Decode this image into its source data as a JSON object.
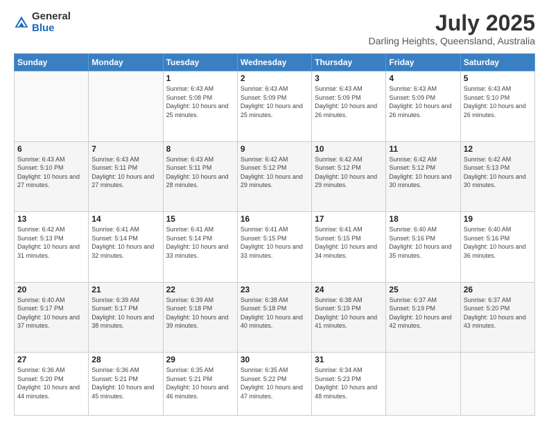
{
  "logo": {
    "general": "General",
    "blue": "Blue"
  },
  "header": {
    "month_year": "July 2025",
    "location": "Darling Heights, Queensland, Australia"
  },
  "days_of_week": [
    "Sunday",
    "Monday",
    "Tuesday",
    "Wednesday",
    "Thursday",
    "Friday",
    "Saturday"
  ],
  "weeks": [
    [
      {
        "day": "",
        "sunrise": "",
        "sunset": "",
        "daylight": ""
      },
      {
        "day": "",
        "sunrise": "",
        "sunset": "",
        "daylight": ""
      },
      {
        "day": "1",
        "sunrise": "Sunrise: 6:43 AM",
        "sunset": "Sunset: 5:08 PM",
        "daylight": "Daylight: 10 hours and 25 minutes."
      },
      {
        "day": "2",
        "sunrise": "Sunrise: 6:43 AM",
        "sunset": "Sunset: 5:09 PM",
        "daylight": "Daylight: 10 hours and 25 minutes."
      },
      {
        "day": "3",
        "sunrise": "Sunrise: 6:43 AM",
        "sunset": "Sunset: 5:09 PM",
        "daylight": "Daylight: 10 hours and 26 minutes."
      },
      {
        "day": "4",
        "sunrise": "Sunrise: 6:43 AM",
        "sunset": "Sunset: 5:09 PM",
        "daylight": "Daylight: 10 hours and 26 minutes."
      },
      {
        "day": "5",
        "sunrise": "Sunrise: 6:43 AM",
        "sunset": "Sunset: 5:10 PM",
        "daylight": "Daylight: 10 hours and 26 minutes."
      }
    ],
    [
      {
        "day": "6",
        "sunrise": "Sunrise: 6:43 AM",
        "sunset": "Sunset: 5:10 PM",
        "daylight": "Daylight: 10 hours and 27 minutes."
      },
      {
        "day": "7",
        "sunrise": "Sunrise: 6:43 AM",
        "sunset": "Sunset: 5:11 PM",
        "daylight": "Daylight: 10 hours and 27 minutes."
      },
      {
        "day": "8",
        "sunrise": "Sunrise: 6:43 AM",
        "sunset": "Sunset: 5:11 PM",
        "daylight": "Daylight: 10 hours and 28 minutes."
      },
      {
        "day": "9",
        "sunrise": "Sunrise: 6:42 AM",
        "sunset": "Sunset: 5:12 PM",
        "daylight": "Daylight: 10 hours and 29 minutes."
      },
      {
        "day": "10",
        "sunrise": "Sunrise: 6:42 AM",
        "sunset": "Sunset: 5:12 PM",
        "daylight": "Daylight: 10 hours and 29 minutes."
      },
      {
        "day": "11",
        "sunrise": "Sunrise: 6:42 AM",
        "sunset": "Sunset: 5:12 PM",
        "daylight": "Daylight: 10 hours and 30 minutes."
      },
      {
        "day": "12",
        "sunrise": "Sunrise: 6:42 AM",
        "sunset": "Sunset: 5:13 PM",
        "daylight": "Daylight: 10 hours and 30 minutes."
      }
    ],
    [
      {
        "day": "13",
        "sunrise": "Sunrise: 6:42 AM",
        "sunset": "Sunset: 5:13 PM",
        "daylight": "Daylight: 10 hours and 31 minutes."
      },
      {
        "day": "14",
        "sunrise": "Sunrise: 6:41 AM",
        "sunset": "Sunset: 5:14 PM",
        "daylight": "Daylight: 10 hours and 32 minutes."
      },
      {
        "day": "15",
        "sunrise": "Sunrise: 6:41 AM",
        "sunset": "Sunset: 5:14 PM",
        "daylight": "Daylight: 10 hours and 33 minutes."
      },
      {
        "day": "16",
        "sunrise": "Sunrise: 6:41 AM",
        "sunset": "Sunset: 5:15 PM",
        "daylight": "Daylight: 10 hours and 33 minutes."
      },
      {
        "day": "17",
        "sunrise": "Sunrise: 6:41 AM",
        "sunset": "Sunset: 5:15 PM",
        "daylight": "Daylight: 10 hours and 34 minutes."
      },
      {
        "day": "18",
        "sunrise": "Sunrise: 6:40 AM",
        "sunset": "Sunset: 5:16 PM",
        "daylight": "Daylight: 10 hours and 35 minutes."
      },
      {
        "day": "19",
        "sunrise": "Sunrise: 6:40 AM",
        "sunset": "Sunset: 5:16 PM",
        "daylight": "Daylight: 10 hours and 36 minutes."
      }
    ],
    [
      {
        "day": "20",
        "sunrise": "Sunrise: 6:40 AM",
        "sunset": "Sunset: 5:17 PM",
        "daylight": "Daylight: 10 hours and 37 minutes."
      },
      {
        "day": "21",
        "sunrise": "Sunrise: 6:39 AM",
        "sunset": "Sunset: 5:17 PM",
        "daylight": "Daylight: 10 hours and 38 minutes."
      },
      {
        "day": "22",
        "sunrise": "Sunrise: 6:39 AM",
        "sunset": "Sunset: 5:18 PM",
        "daylight": "Daylight: 10 hours and 39 minutes."
      },
      {
        "day": "23",
        "sunrise": "Sunrise: 6:38 AM",
        "sunset": "Sunset: 5:18 PM",
        "daylight": "Daylight: 10 hours and 40 minutes."
      },
      {
        "day": "24",
        "sunrise": "Sunrise: 6:38 AM",
        "sunset": "Sunset: 5:19 PM",
        "daylight": "Daylight: 10 hours and 41 minutes."
      },
      {
        "day": "25",
        "sunrise": "Sunrise: 6:37 AM",
        "sunset": "Sunset: 5:19 PM",
        "daylight": "Daylight: 10 hours and 42 minutes."
      },
      {
        "day": "26",
        "sunrise": "Sunrise: 6:37 AM",
        "sunset": "Sunset: 5:20 PM",
        "daylight": "Daylight: 10 hours and 43 minutes."
      }
    ],
    [
      {
        "day": "27",
        "sunrise": "Sunrise: 6:36 AM",
        "sunset": "Sunset: 5:20 PM",
        "daylight": "Daylight: 10 hours and 44 minutes."
      },
      {
        "day": "28",
        "sunrise": "Sunrise: 6:36 AM",
        "sunset": "Sunset: 5:21 PM",
        "daylight": "Daylight: 10 hours and 45 minutes."
      },
      {
        "day": "29",
        "sunrise": "Sunrise: 6:35 AM",
        "sunset": "Sunset: 5:21 PM",
        "daylight": "Daylight: 10 hours and 46 minutes."
      },
      {
        "day": "30",
        "sunrise": "Sunrise: 6:35 AM",
        "sunset": "Sunset: 5:22 PM",
        "daylight": "Daylight: 10 hours and 47 minutes."
      },
      {
        "day": "31",
        "sunrise": "Sunrise: 6:34 AM",
        "sunset": "Sunset: 5:23 PM",
        "daylight": "Daylight: 10 hours and 48 minutes."
      },
      {
        "day": "",
        "sunrise": "",
        "sunset": "",
        "daylight": ""
      },
      {
        "day": "",
        "sunrise": "",
        "sunset": "",
        "daylight": ""
      }
    ]
  ]
}
